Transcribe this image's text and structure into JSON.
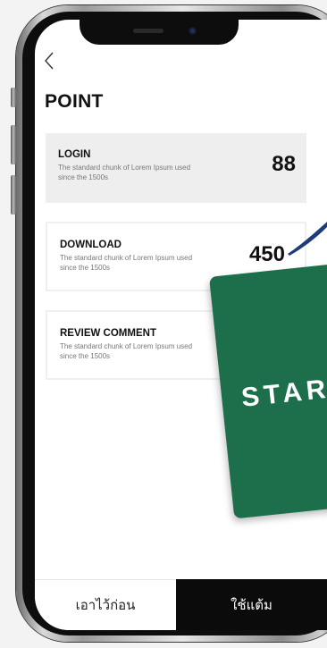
{
  "header": {
    "title": "POINT"
  },
  "cards": [
    {
      "title": "LOGIN",
      "description": "The standard chunk of Lorem Ipsum used since the 1500s",
      "points": "88"
    },
    {
      "title": "DOWNLOAD",
      "description": "The standard chunk of Lorem Ipsum used since the 1500s",
      "points": "450"
    },
    {
      "title": "REVIEW COMMENT",
      "description": "The standard chunk of Lorem Ipsum used since the 1500s",
      "points": ""
    }
  ],
  "promo": {
    "text": "STAR"
  },
  "footer": {
    "later_label": "เอาไว้ก่อน",
    "use_label": "ใช้แต้ม"
  },
  "colors": {
    "promo_green": "#1c6f4a",
    "primary_button": "#0b0b0b",
    "card_fill": "#eeeeee"
  },
  "icons": {
    "back": "chevron-left-icon"
  }
}
